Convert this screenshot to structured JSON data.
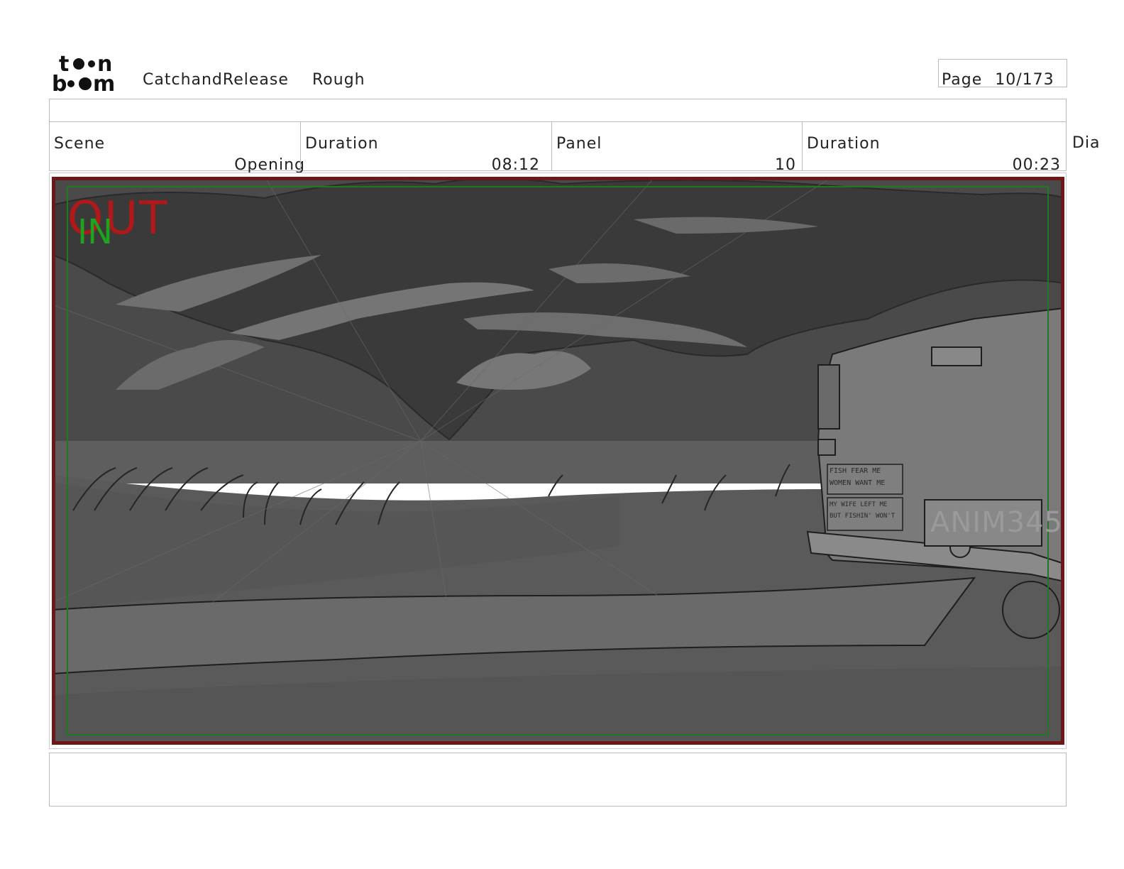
{
  "header": {
    "logo_text": "toon boom",
    "project": "CatchandRelease",
    "version": "Rough",
    "page_label": "Page",
    "page_value": "10/173"
  },
  "info": {
    "scene_label": "Scene",
    "scene_value": "Opening",
    "scene_duration_label": "Duration",
    "scene_duration_value": "08:12",
    "panel_label": "Panel",
    "panel_value": "10",
    "panel_duration_label": "Duration",
    "panel_duration_value": "00:23",
    "dialog_label": "Dia"
  },
  "panel_overlay": {
    "out_text": "OUT",
    "in_text": "IN",
    "bumper_sticker_1": "FISH FEAR ME WOMEN WANT ME",
    "bumper_sticker_2": "MY WIFE LEFT ME BUT FISHIN' WON'T",
    "license_plate": "ANIM345"
  },
  "colors": {
    "out_marker": "#b0181a",
    "in_marker": "#1fa31f",
    "sky": "#4a4a4a",
    "cloud": "#6f6f6f",
    "ground": "#5c5c5c"
  }
}
